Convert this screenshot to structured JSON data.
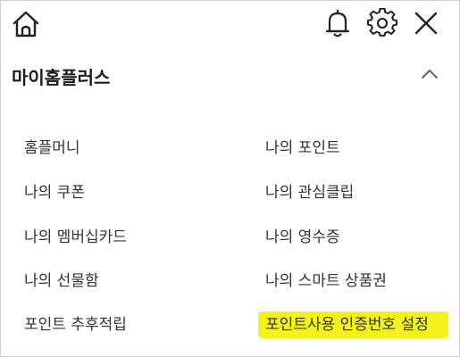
{
  "topbar": {
    "icons": [
      "home-icon",
      "bell-icon",
      "gear-icon",
      "close-icon"
    ]
  },
  "section": {
    "title": "마이홈플러스",
    "expanded": true,
    "chevron_icon": "chevron-up-icon"
  },
  "menu": {
    "left": [
      "홈플머니",
      "나의 쿠폰",
      "나의 멤버십카드",
      "나의 선물함",
      "포인트 추후적립"
    ],
    "right": [
      "나의 포인트",
      "나의 관심클립",
      "나의 영수증",
      "나의 스마트 상품권",
      "포인트사용 인증번호 설정"
    ]
  },
  "colors": {
    "highlight": "#f3f21a",
    "text": "#333333",
    "border": "#cfcfcf"
  }
}
